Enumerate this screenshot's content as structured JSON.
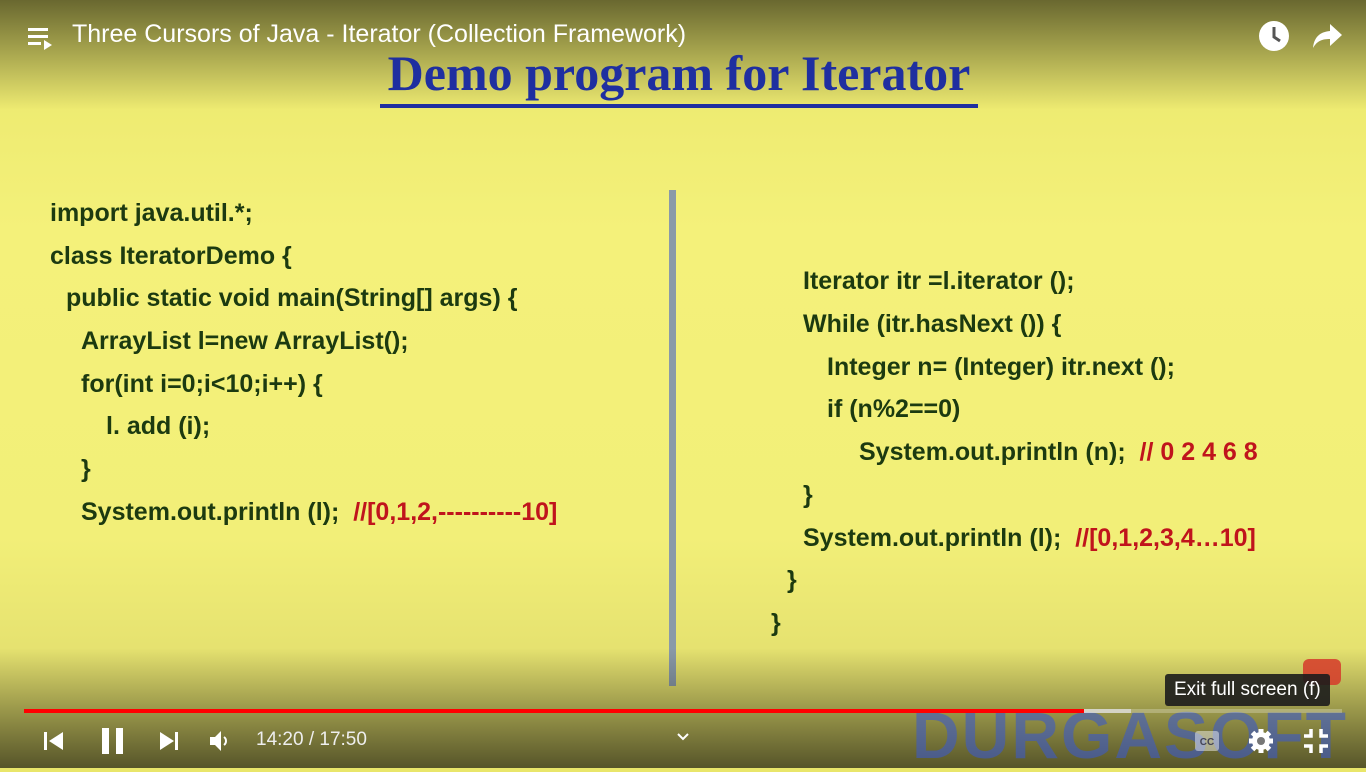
{
  "video": {
    "title": "Three Cursors of Java - Iterator (Collection Framework)",
    "current_time": "14:20",
    "duration": "17:50",
    "time_display": "14:20 / 17:50",
    "progress_fraction": 0.804,
    "buffered_fraction": 0.84,
    "progress_color": "#ff0000"
  },
  "slide": {
    "title": "Demo program for Iterator",
    "left_code": [
      {
        "text": "import java.util.*;",
        "comment": ""
      },
      {
        "text": "class IteratorDemo {",
        "comment": ""
      },
      {
        "text": "public static void main(String[] args) {",
        "comment": ""
      },
      {
        "text": "ArrayList l=new ArrayList();",
        "comment": ""
      },
      {
        "text": "for(int i=0;i<10;i++) {",
        "comment": ""
      },
      {
        "text": "l. add (i);",
        "comment": ""
      },
      {
        "text": "}",
        "comment": ""
      },
      {
        "text": "System.out.println (l);  ",
        "comment": "//[0,1,2,----------10]"
      }
    ],
    "right_code": [
      {
        "text": "Iterator itr =l.iterator ();",
        "comment": ""
      },
      {
        "text": "While (itr.hasNext ()) {",
        "comment": ""
      },
      {
        "text": "Integer n= (Integer) itr.next ();",
        "comment": ""
      },
      {
        "text": "if (n%2==0)",
        "comment": ""
      },
      {
        "text": "System.out.println (n);  ",
        "comment": "// 0 2 4 6 8"
      },
      {
        "text": "}",
        "comment": ""
      },
      {
        "text": "System.out.println (l);  ",
        "comment": "//[0,1,2,3,4…10]"
      },
      {
        "text": "}",
        "comment": ""
      },
      {
        "text": "}",
        "comment": ""
      }
    ],
    "watermark": "DURGASOFT"
  },
  "controls": {
    "tooltip": "Exit full screen (f)",
    "icons": [
      "playlist-icon",
      "watch-later-icon",
      "share-icon",
      "previous-icon",
      "pause-icon",
      "next-icon",
      "volume-icon",
      "chevron-down-icon",
      "captions-icon",
      "settings-icon",
      "exit-fullscreen-icon"
    ]
  }
}
